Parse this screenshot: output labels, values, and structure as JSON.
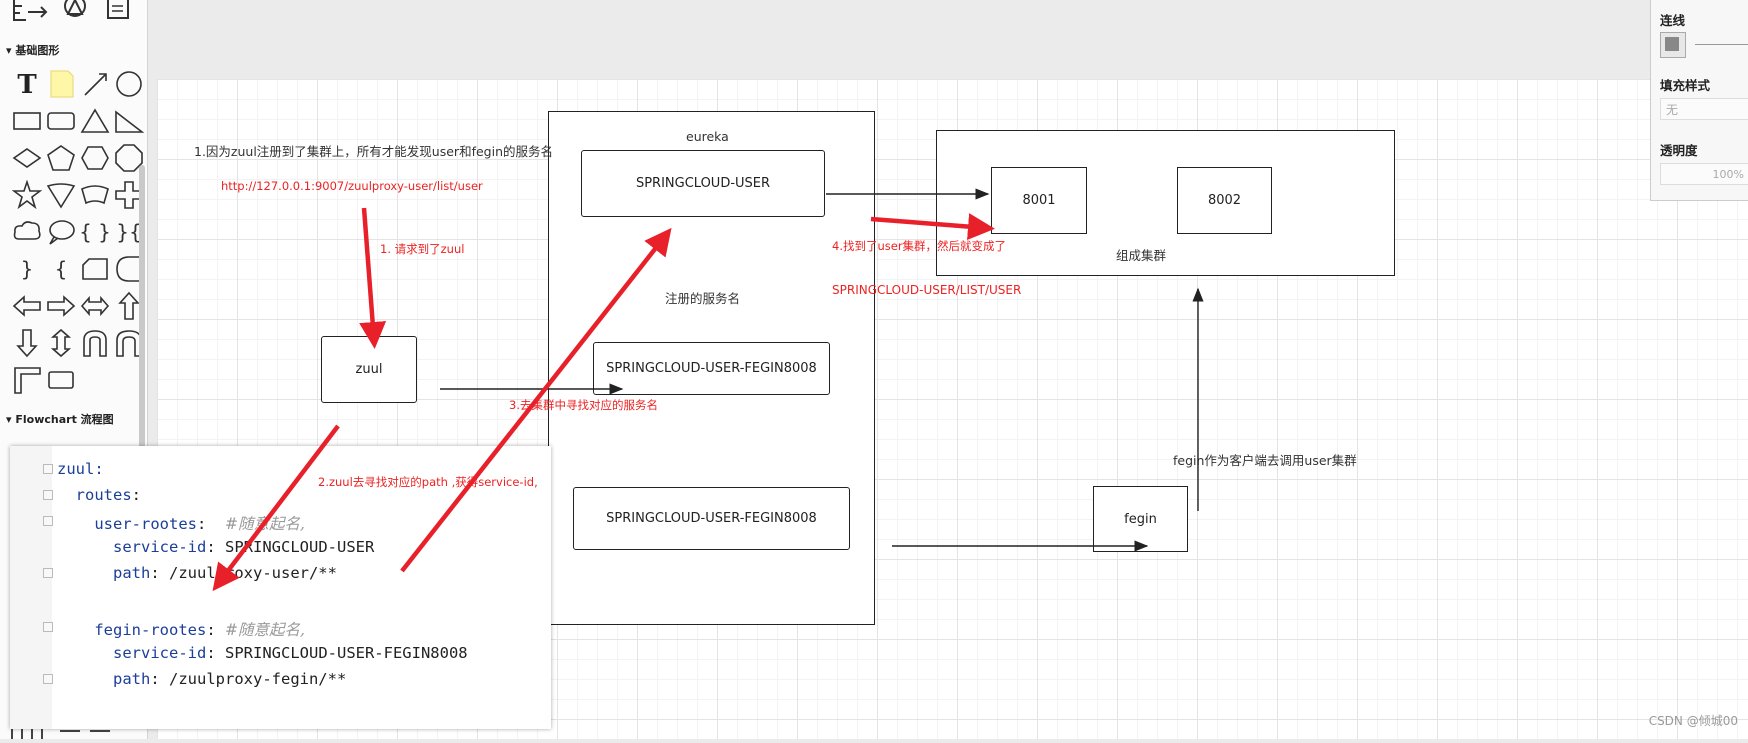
{
  "sidebar": {
    "section_basic": "基础图形",
    "section_flowchart": "Flowchart 流程图"
  },
  "diagram": {
    "note_top": "1.因为zuul注册到了集群上，所有才能发现user和fegin的服务名",
    "url": "http://127.0.0.1:9007/zuulproxy-user/list/user",
    "step1": "1. 请求到了zuul",
    "step2": "2.zuul去寻找对应的path ,获得service-id,",
    "step3": "3.去集群中寻找对应的服务名",
    "step4": "4.找到了user集群，然后就变成了",
    "path_result": "SPRINGCLOUD-USER/LIST/USER",
    "eureka": "eureka",
    "registered": "注册的服务名",
    "svc_user": "SPRINGCLOUD-USER",
    "svc_fegin1": "SPRINGCLOUD-USER-FEGIN8008",
    "svc_fegin2": "SPRINGCLOUD-USER-FEGIN8008",
    "zuul": "zuul",
    "fegin": "fegin",
    "port1": "8001",
    "port2": "8002",
    "cluster": "组成集群",
    "fegin_note": "fegin作为客户端去调用user集群"
  },
  "code": {
    "l1": "zuul:",
    "l2_key": "routes",
    "l3_key": "user-rootes",
    "l3_comment": "#随意起名,",
    "l4_key": "service-id",
    "l4_val": "SPRINGCLOUD-USER",
    "l5_key": "path",
    "l5_val": "/zuulproxy-user/**",
    "l6_key": "fegin-rootes",
    "l6_comment": "#随意起名,",
    "l7_key": "service-id",
    "l7_val": "SPRINGCLOUD-USER-FEGIN8008",
    "l8_key": "path",
    "l8_val": "/zuulproxy-fegin/**"
  },
  "format_panel": {
    "line": "连线",
    "fill": "填充样式",
    "fill_value": "无",
    "opacity": "透明度",
    "opacity_value": "100%"
  },
  "watermark": "CSDN @倾城00",
  "colors": {
    "annotation_red": "#ee2222",
    "arrow_red": "#e8202a"
  }
}
